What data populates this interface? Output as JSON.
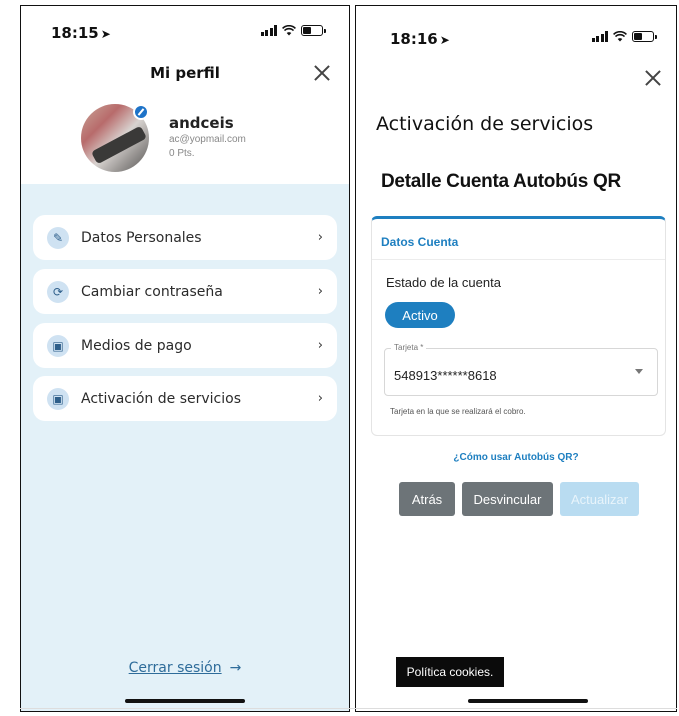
{
  "left": {
    "time": "18:15",
    "title": "Mi perfil",
    "profile": {
      "username": "andceis",
      "email": "ac@yopmail.com",
      "points": "0 Pts."
    },
    "menu": [
      {
        "label": "Datos Personales",
        "icon": "pencil-icon",
        "glyph": "✎"
      },
      {
        "label": "Cambiar contraseña",
        "icon": "refresh-icon",
        "glyph": "⟳"
      },
      {
        "label": "Medios de pago",
        "icon": "wallet-icon",
        "glyph": "▣"
      },
      {
        "label": "Activación de servicios",
        "icon": "wallet-icon",
        "glyph": "▣"
      }
    ],
    "logout_label": "Cerrar sesión",
    "logout_icon": "→",
    "chevron": "›"
  },
  "right": {
    "time": "18:16",
    "title": "Activación de servicios",
    "subtitle": "Detalle Cuenta Autobús QR",
    "card": {
      "title": "Datos Cuenta",
      "status_label": "Estado de la cuenta",
      "status_value": "Activo",
      "card_field_label": "Tarjeta *",
      "card_field_value": "548913******8618",
      "card_field_help": "Tarjeta en la que se realizará el cobro."
    },
    "howto_link": "¿Cómo usar Autobús QR?",
    "buttons": {
      "back": "Atrás",
      "unlink": "Desvincular",
      "update": "Actualizar"
    },
    "cookies": "Política cookies."
  },
  "colors": {
    "accent": "#1e7fc0",
    "menu_background": "#e3f1f8",
    "button_gray": "#6d7478",
    "button_disabled": "#b9dcf1"
  }
}
